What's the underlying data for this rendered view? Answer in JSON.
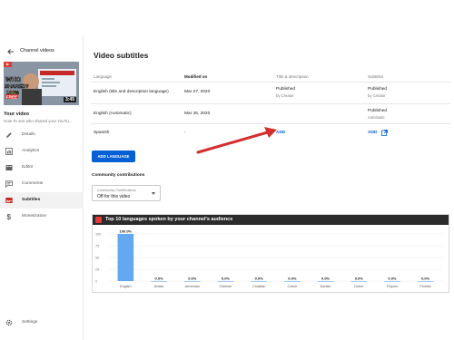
{
  "sidebar": {
    "header_title": "Channel videos",
    "thumbnail": {
      "time": "3:45",
      "overlay_texts": [
        "WHO",
        "SHARED?",
        "100%",
        "FREE"
      ]
    },
    "your_video_label": "Your video",
    "your_video_sub": "How To see who shared your YouTu...",
    "items": [
      {
        "label": "Details",
        "icon": "pencil-icon"
      },
      {
        "label": "Analytics",
        "icon": "analytics-icon"
      },
      {
        "label": "Editor",
        "icon": "editor-icon"
      },
      {
        "label": "Comments",
        "icon": "comments-icon"
      },
      {
        "label": "Subtitles",
        "icon": "subtitles-icon"
      },
      {
        "label": "Monetization",
        "icon": "dollar-icon"
      }
    ],
    "settings_label": "Settings",
    "active_item": "Subtitles"
  },
  "main": {
    "title": "Video subtitles",
    "columns": [
      "Language",
      "Modified on",
      "Title & description",
      "Subtitles"
    ],
    "rows": [
      {
        "language": "English (title and description language)",
        "modified": "Mar 27, 2020",
        "title_status": "Published",
        "title_by": "by Creator",
        "subs_status": "Published",
        "subs_by": "by Creator"
      },
      {
        "language": "English (Automatic)",
        "modified": "Mar 26, 2020",
        "title_status": "",
        "title_by": "",
        "subs_status": "Published",
        "subs_by": "Automatic"
      },
      {
        "language": "Spanish",
        "modified": "-",
        "title_action": "ADD",
        "subs_action": "ADD"
      }
    ],
    "add_language_button": "ADD LANGUAGE",
    "community_title": "Community contributions",
    "dropdown_label": "Community Contributions",
    "dropdown_value": "Off for this video"
  },
  "chart_data": {
    "type": "bar",
    "title": "Top 10 languages spoken by your channel's audience",
    "categories": [
      "English",
      "Arabic",
      "Armenian",
      "Chinese",
      "Croatian",
      "Czech",
      "Danish",
      "Dutch",
      "Filipino",
      "Finnish"
    ],
    "values": [
      100.0,
      0.0,
      0.0,
      0.0,
      0.0,
      0.0,
      0.0,
      0.0,
      0.0,
      0.0
    ],
    "value_labels": [
      "100.0%",
      "0.0%",
      "0.0%",
      "0.0%",
      "0.0%",
      "0.0%",
      "0.0%",
      "0.0%",
      "0.0%",
      "0.0%"
    ],
    "yticks": [
      0,
      25,
      50,
      75,
      100
    ],
    "ylim": [
      0,
      100
    ],
    "bar_color": "#64a8f0",
    "grid": true
  },
  "colors": {
    "accent": "#065fd4",
    "arrow": "#d32f2f",
    "header_bg": "#2b2b2b"
  }
}
